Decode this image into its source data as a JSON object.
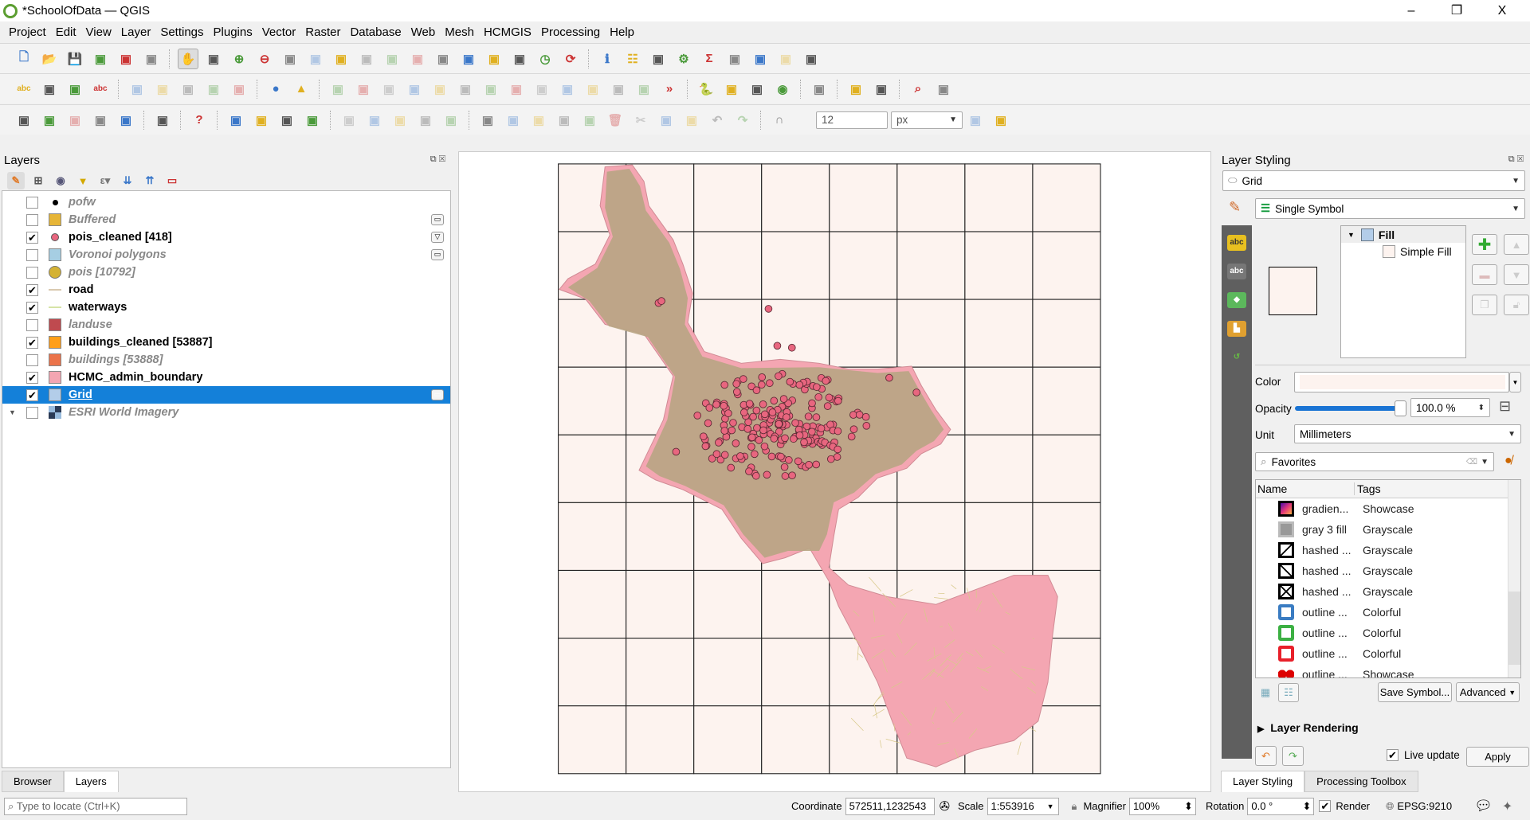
{
  "window": {
    "title": "*SchoolOfData — QGIS",
    "minimize": "–",
    "restore": "❐",
    "close": "X"
  },
  "menu": [
    "Project",
    "Edit",
    "View",
    "Layer",
    "Settings",
    "Plugins",
    "Vector",
    "Raster",
    "Database",
    "Web",
    "Mesh",
    "HCMGIS",
    "Processing",
    "Help"
  ],
  "toolbars": [
    [
      "new-project",
      "open-project",
      "save-project",
      "new-print-layout",
      "layout-manager",
      "style-manager",
      "|",
      "pan",
      "pan-to-selection",
      "zoom-in",
      "zoom-out",
      "zoom-full",
      "zoom-to-selection",
      "zoom-to-layer",
      "zoom-native",
      "zoom-last",
      "zoom-next",
      "new-map-view",
      "new-3d-map-view",
      "new-bookmark",
      "show-bookmarks",
      "temporal-controller",
      "refresh",
      "|",
      "identify",
      "attribute-table",
      "statistics",
      "toolbox",
      "sum",
      "measure",
      "annotation",
      "map-tips",
      "text-annotation"
    ],
    [
      "label-tool",
      "diagram",
      "pin-label",
      "highlight-label",
      "|",
      "move-label",
      "show-hide-label",
      "rotate-label",
      "change-label",
      "label-props",
      "|",
      "globe-plugin",
      "triangle-plugin",
      "|",
      "digitize-1",
      "digitize-2",
      "digitize-3",
      "digitize-4",
      "digitize-5",
      "digitize-6",
      "digitize-7",
      "digitize-8",
      "digitize-9",
      "digitize-10",
      "digitize-11",
      "digitize-12",
      "digitize-13",
      "more",
      "|",
      "python-console",
      "build-tool",
      "undo-plugin",
      "earth",
      "|",
      "profile",
      "|",
      "georeferencer",
      "table-refresh",
      "|",
      "quick-search",
      "map-swipe"
    ],
    [
      "add-vector-layer",
      "add-raster-layer",
      "digitize-vertex",
      "feather",
      "memory-layer",
      "|",
      "virtual-layer",
      "|",
      "help",
      "|",
      "select-features",
      "select-by-attribute",
      "deselect",
      "select-by-location",
      "|",
      "add-point",
      "add-circle",
      "add-ellipse",
      "add-rect",
      "add-polygon",
      "|",
      "edit-pencil",
      "toggle-edit",
      "save-edits",
      "add-feature",
      "vertex-tool",
      "delete",
      "cut",
      "copy",
      "paste",
      "undo",
      "redo",
      "|",
      "snapping-magnet",
      "snap-config",
      "tracing"
    ]
  ],
  "snapping": {
    "tolerance": "12",
    "unit": "px"
  },
  "layers_panel": {
    "title": "Layers",
    "items": [
      {
        "name": "pofw",
        "checked": false,
        "symbol": "dot",
        "color": "#000000"
      },
      {
        "name": "Buffered",
        "checked": false,
        "symbol": "fill",
        "color": "#e6b537",
        "indicator": "embedded"
      },
      {
        "name": "pois_cleaned [418]",
        "checked": true,
        "symbol": "circle",
        "color": "#e8667f",
        "indicator": "filter"
      },
      {
        "name": "Voronoi polygons",
        "checked": false,
        "symbol": "fill",
        "color": "#a6cee3",
        "indicator": "embedded"
      },
      {
        "name": "pois [10792]",
        "checked": false,
        "symbol": "bigcircle",
        "color": "#d4b234"
      },
      {
        "name": "road",
        "checked": true,
        "symbol": "line",
        "color": "#d9c9b0"
      },
      {
        "name": "waterways",
        "checked": true,
        "symbol": "line",
        "color": "#d6e4a6"
      },
      {
        "name": "landuse",
        "checked": false,
        "symbol": "fill",
        "color": "#bf4a4f"
      },
      {
        "name": "buildings_cleaned [53887]",
        "checked": true,
        "symbol": "fill",
        "color": "#ff9f1a"
      },
      {
        "name": "buildings [53888]",
        "checked": false,
        "symbol": "fill",
        "color": "#eb734a"
      },
      {
        "name": "HCMC_admin_boundary",
        "checked": true,
        "symbol": "fill",
        "color": "#f4a6b2"
      },
      {
        "name": "Grid",
        "checked": true,
        "symbol": "fill",
        "color": "#b3cde9",
        "selected": true,
        "indicator": "embedded"
      },
      {
        "name": "ESRI World Imagery",
        "checked": false,
        "symbol": "raster",
        "color": "#2b3a55",
        "expander": true
      }
    ],
    "tabs": [
      "Browser",
      "Layers"
    ],
    "active_tab": "Layers"
  },
  "map": {
    "grid_fill": "#fdf3ef",
    "boundary_fill": "#f4a6b2",
    "urban_fill": "#b8a583",
    "poi_fill": "#e8667f"
  },
  "styling": {
    "title": "Layer Styling",
    "layer": "Grid",
    "renderer": "Single Symbol",
    "tree": {
      "root": "Fill",
      "child": "Simple Fill"
    },
    "color_label": "Color",
    "color_value": "#fdf3ef",
    "opacity_label": "Opacity",
    "opacity_value": "100.0 %",
    "opacity": 1.0,
    "unit_label": "Unit",
    "unit_value": "Millimeters",
    "search_placeholder": "Favorites",
    "columns": [
      "Name",
      "Tags"
    ],
    "symbols": [
      {
        "name": "gradien...",
        "tag": "Showcase",
        "style": "gradient"
      },
      {
        "name": "gray 3 fill",
        "tag": "Grayscale",
        "style": "gray"
      },
      {
        "name": "hashed ...",
        "tag": "Grayscale",
        "style": "hash1"
      },
      {
        "name": "hashed ...",
        "tag": "Grayscale",
        "style": "hash2"
      },
      {
        "name": "hashed ...",
        "tag": "Grayscale",
        "style": "hash3"
      },
      {
        "name": "outline ...",
        "tag": "Colorful",
        "style": "#3a7cc2"
      },
      {
        "name": "outline ...",
        "tag": "Colorful",
        "style": "#3cb043"
      },
      {
        "name": "outline ...",
        "tag": "Colorful",
        "style": "#e8202a"
      },
      {
        "name": "outline ...",
        "tag": "Showcase",
        "style": "dots"
      }
    ],
    "save_symbol": "Save Symbol...",
    "advanced": "Advanced",
    "layer_rendering": "Layer Rendering",
    "live_update": "Live update",
    "live_update_checked": true,
    "apply": "Apply",
    "tabs": [
      "Layer Styling",
      "Processing Toolbox"
    ],
    "active_tab": "Layer Styling"
  },
  "status": {
    "locate_placeholder": "Type to locate (Ctrl+K)",
    "coordinate_label": "Coordinate",
    "coordinate": "572511,1232543",
    "scale_label": "Scale",
    "scale": "1:553916",
    "magnifier_label": "Magnifier",
    "magnifier": "100%",
    "rotation_label": "Rotation",
    "rotation": "0.0 °",
    "render_label": "Render",
    "render_checked": true,
    "crs": "EPSG:9210"
  }
}
